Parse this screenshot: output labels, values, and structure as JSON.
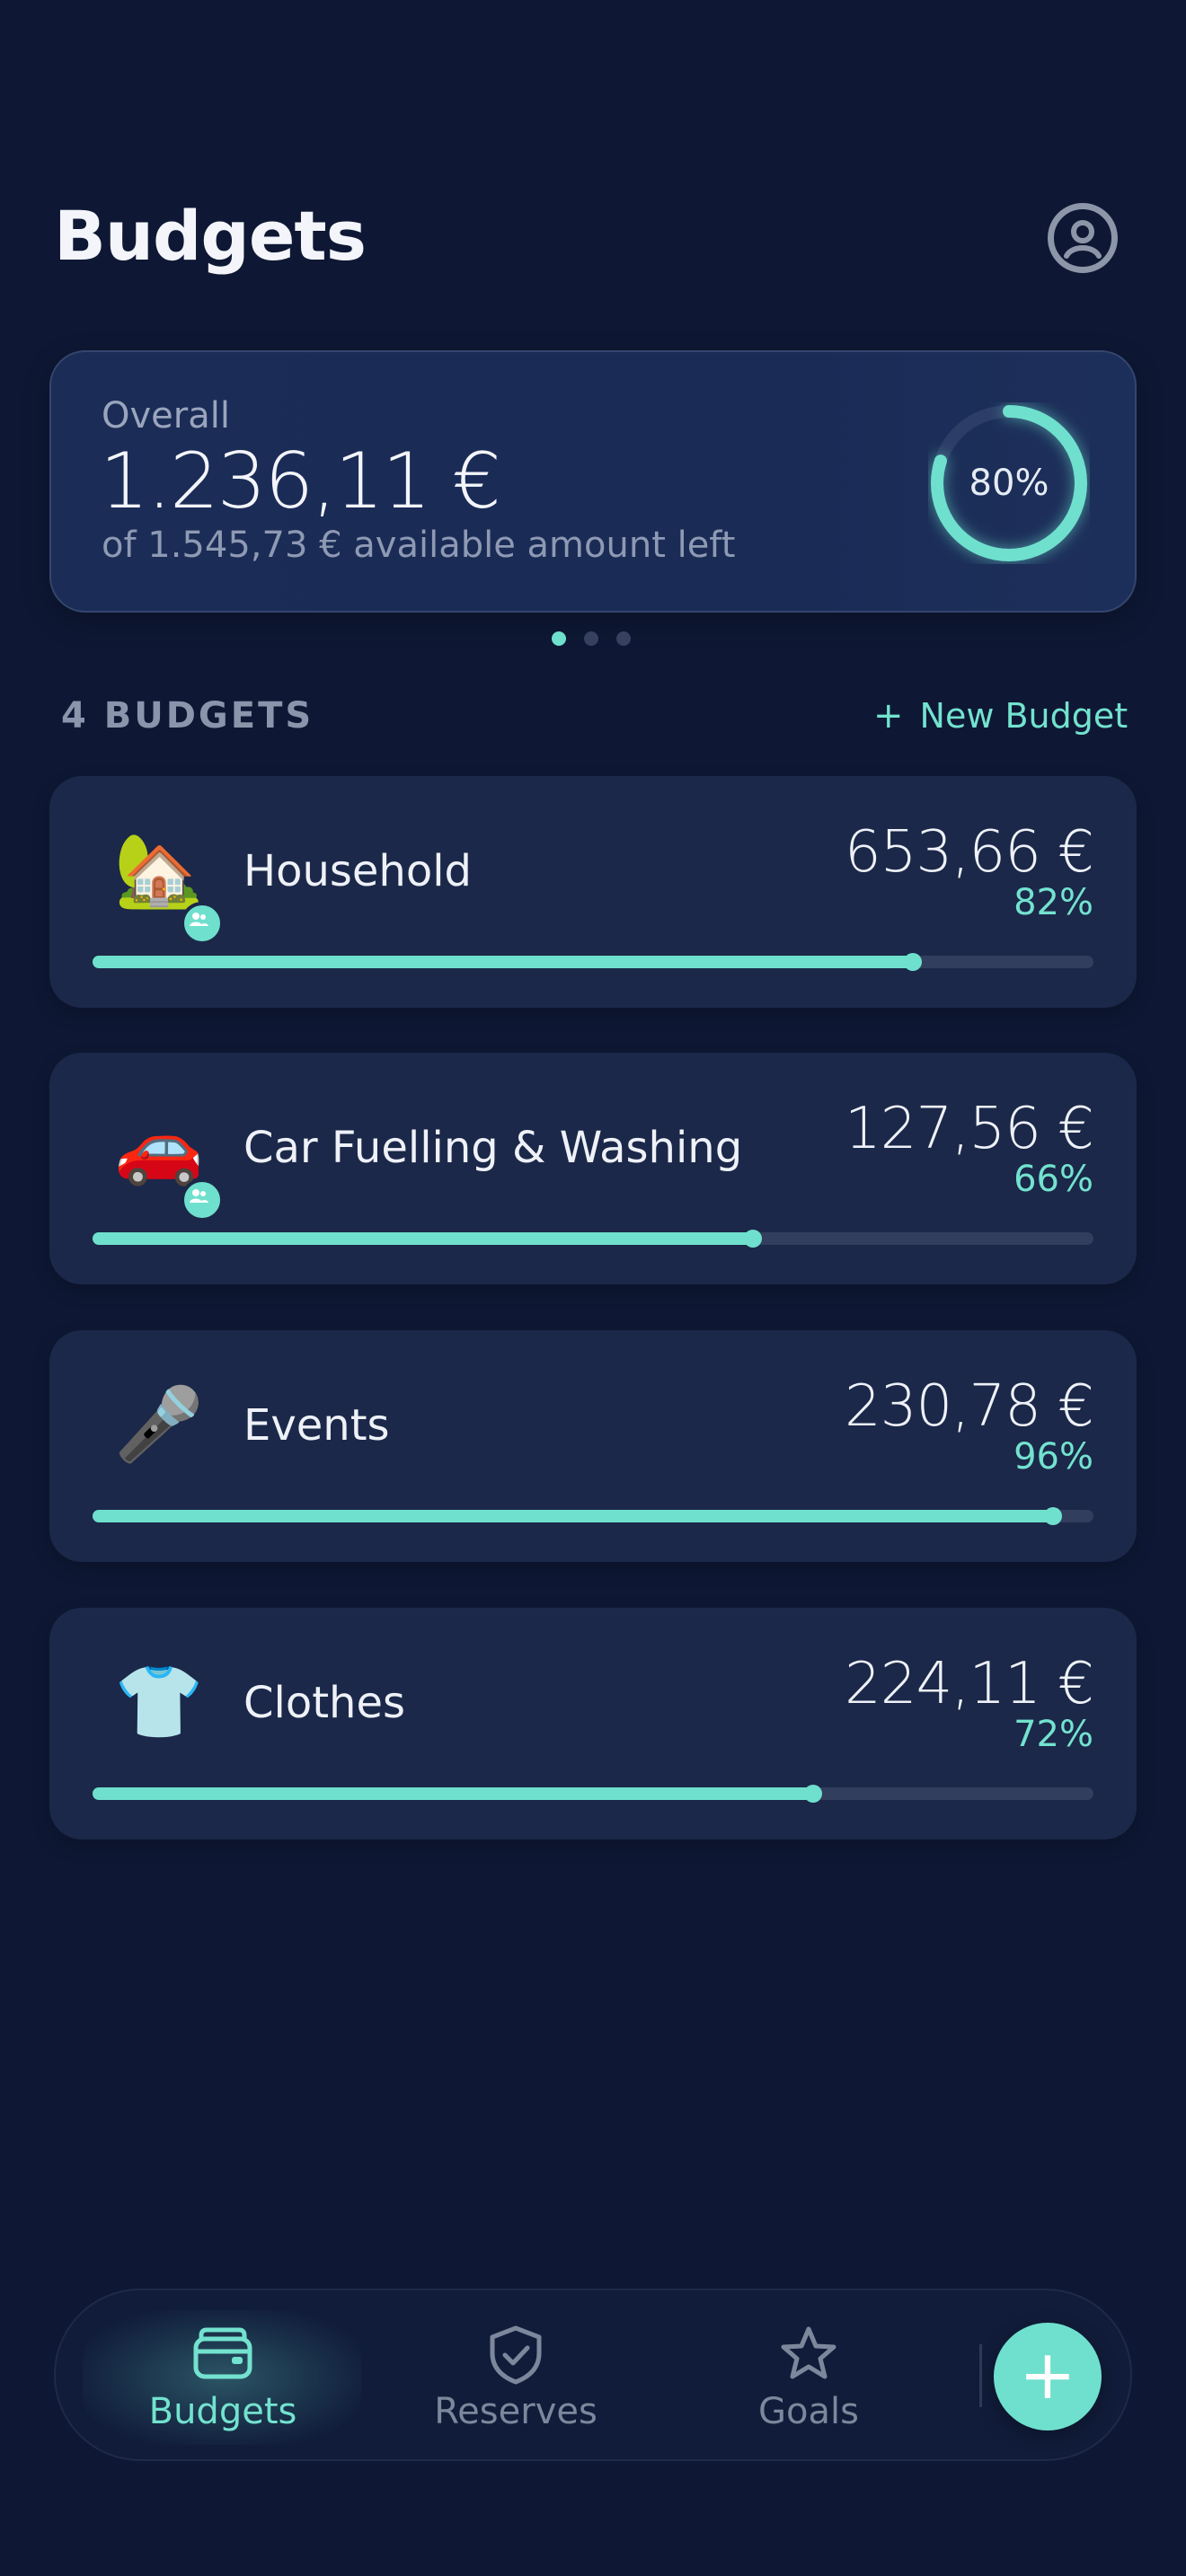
{
  "header": {
    "title": "Budgets"
  },
  "overall": {
    "label": "Overall",
    "amount": "1.236,11 €",
    "subtitle": "of 1.545,73 € available amount left",
    "percent_label": "80%",
    "percent": 0.8
  },
  "carousel": {
    "pages": 3,
    "active": 0
  },
  "budgets_section": {
    "title": "4 BUDGETS",
    "new_plus": "+",
    "new_label": "New Budget"
  },
  "budgets": [
    {
      "icon": "🏡",
      "icon_name": "house-with-garden-icon",
      "shared": true,
      "name": "Household",
      "amount": "653,66 €",
      "percent_label": "82%",
      "progress": 0.82
    },
    {
      "icon": "🚗",
      "icon_name": "car-icon",
      "shared": true,
      "name": "Car Fuelling & Washing",
      "amount": "127,56 €",
      "percent_label": "66%",
      "progress": 0.66
    },
    {
      "icon": "🎤",
      "icon_name": "microphone-icon",
      "shared": false,
      "name": "Events",
      "amount": "230,78 €",
      "percent_label": "96%",
      "progress": 0.96
    },
    {
      "icon": "👕",
      "icon_name": "shirt-icon",
      "shared": false,
      "name": "Clothes",
      "amount": "224,11 €",
      "percent_label": "72%",
      "progress": 0.72
    }
  ],
  "nav": {
    "items": [
      {
        "label": "Budgets",
        "icon": "wallet-icon",
        "active": true
      },
      {
        "label": "Reserves",
        "icon": "shield-check-icon",
        "active": false
      },
      {
        "label": "Goals",
        "icon": "star-icon",
        "active": false
      }
    ],
    "fab_symbol": "+"
  },
  "colors": {
    "background": "#0e1834",
    "card": "#1b2849",
    "accent": "#6fe0cd",
    "muted": "#8a94ab"
  }
}
